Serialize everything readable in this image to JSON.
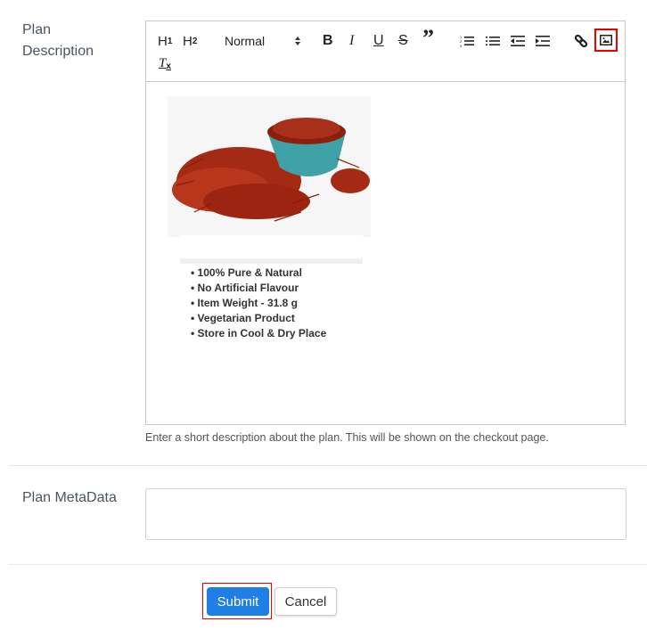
{
  "fields": {
    "description_label": "Plan Description",
    "metadata_label": "Plan MetaData",
    "description_help": "Enter a short description about the plan. This will be shown on the checkout page.",
    "metadata_value": ""
  },
  "toolbar": {
    "h1": "H",
    "h1_sub": "1",
    "h2": "H",
    "h2_sub": "2",
    "format_select": "Normal",
    "bold": "B",
    "italic": "I",
    "underline": "U",
    "strike": "S",
    "quote": "”",
    "highlighted_button": "image"
  },
  "editor_content": {
    "image_alt": "Saffron threads in a teal bowl",
    "bullets": [
      "100% Pure & Natural",
      "No Artificial Flavour",
      "Item Weight - 31.8 g",
      "Vegetarian Product",
      "Store in Cool & Dry Place"
    ]
  },
  "actions": {
    "submit": "Submit",
    "cancel": "Cancel"
  },
  "colors": {
    "primary": "#1f7fe5",
    "highlight": "#e00000"
  }
}
